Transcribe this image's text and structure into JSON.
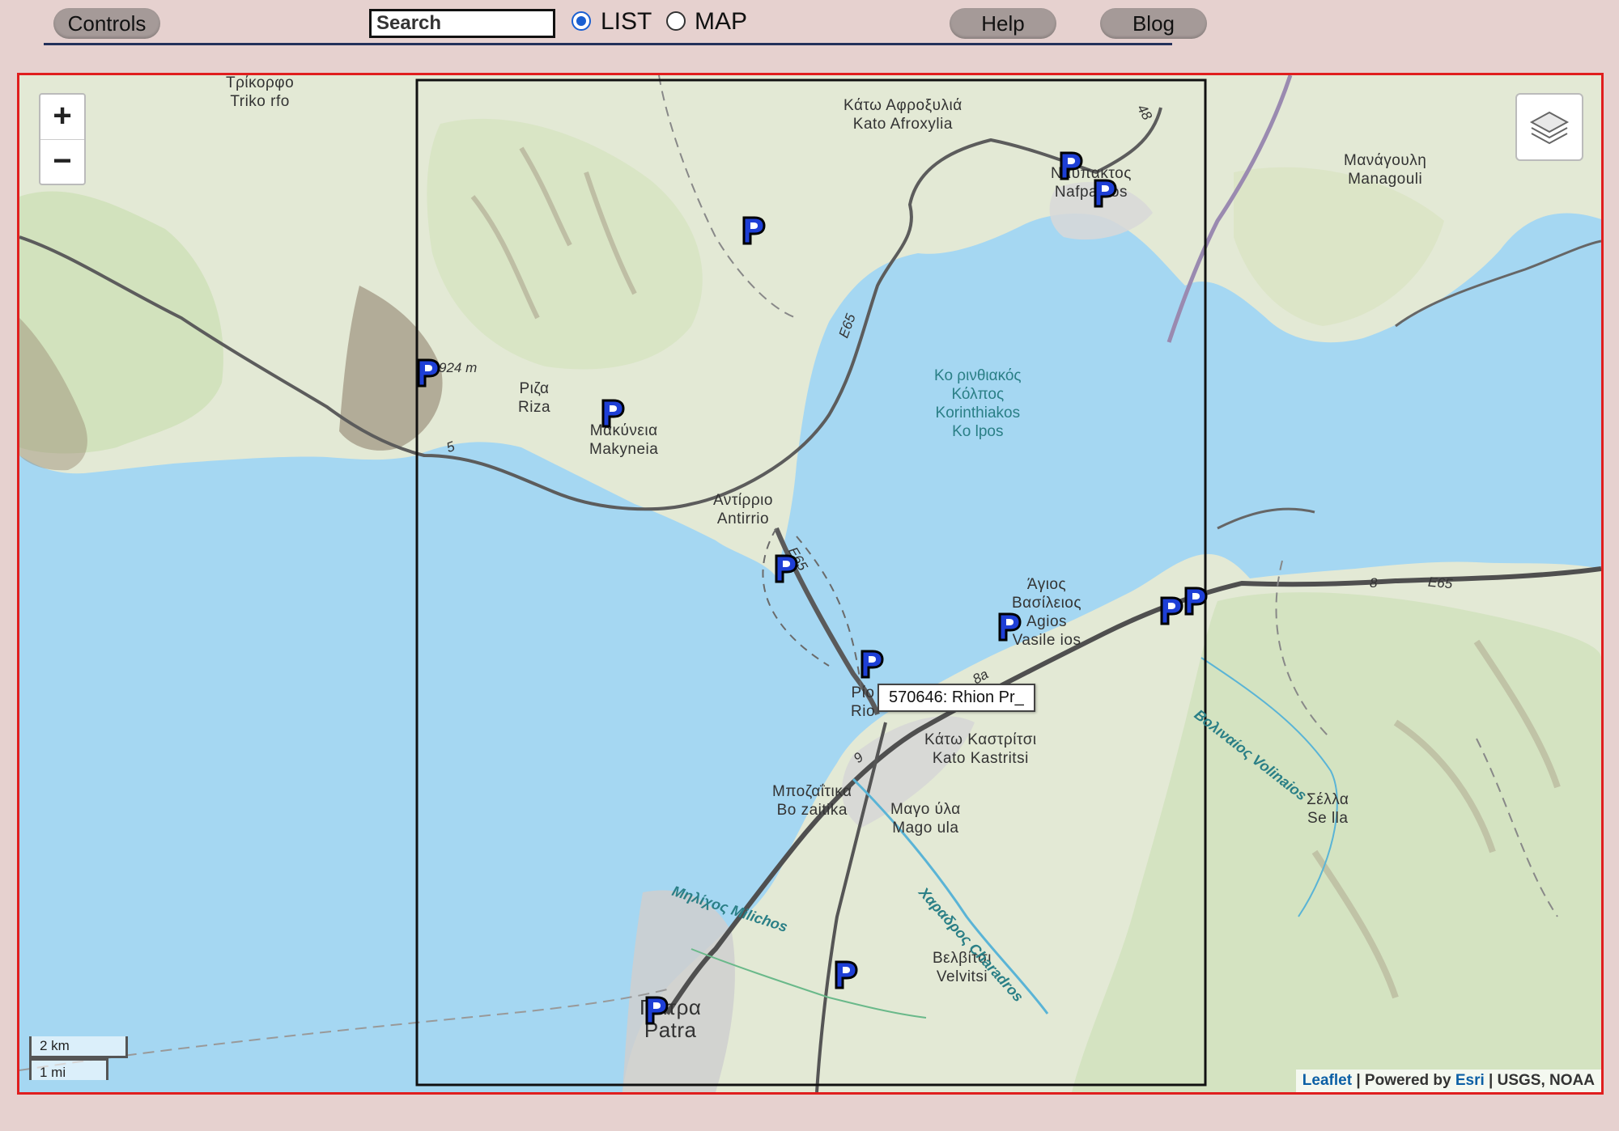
{
  "toolbar": {
    "controls_label": "Controls",
    "search_placeholder": "Search",
    "list_label": "LIST",
    "map_label": "MAP",
    "help_label": "Help",
    "blog_label": "Blog",
    "view_selected": "LIST"
  },
  "map": {
    "zoom_in": "+",
    "zoom_out": "−",
    "layers_icon": "layers-icon",
    "tooltip": "570646: Rhion Pr_",
    "scale_km": "2 km",
    "scale_mi": "1 mi",
    "attribution": {
      "leaflet": "Leaflet",
      "sep1": " | Powered by ",
      "esri": "Esri",
      "rest": " | USGS, NOAA"
    },
    "places": {
      "trikorfo_gr": "Τρίκορφο",
      "trikorfo_en": "Triko rfo",
      "afroxylia_gr": "Κάτω Αφροξυλιά",
      "afroxylia_en": "Kato Afroxylia",
      "nafpaktos_gr": "Ναυπακτος",
      "nafpaktos_en": "Nafpaktos",
      "managouli_gr": "Μανάγουλη",
      "managouli_en": "Managouli",
      "riza_gr": "Ριζα",
      "riza_en": "Riza",
      "makyneia_gr": "Μακύνεια",
      "makyneia_en": "Makyneia",
      "antirrio_gr": "Αντίρριο",
      "antirrio_en": "Antirrio",
      "gulf_gr1": "Κο ρινθιακός",
      "gulf_gr2": "Κόλπος",
      "gulf_en1": "Korinthiakos",
      "gulf_en2": "Ko lpos",
      "agios_gr1": "Άγιος",
      "agios_gr2": "Βασίλειος",
      "agios_en1": "Agios",
      "agios_en2": "Vasile ios",
      "rio_gr": "Ρίο",
      "rio_en": "Rio",
      "kastritsi_gr": "Κάτω Καστρίτσι",
      "kastritsi_en": "Kato Kastritsi",
      "bozaitika_gr": "Μποζαΐτικα",
      "bozaitika_en": "Bo zaitika",
      "magoula_gr": "Μαγο ύλα",
      "magoula_en": "Mago ula",
      "sella_gr": "Σέλλα",
      "sella_en": "Se lla",
      "velvitsi_gr": "Βελβίτσι",
      "velvitsi_en": "Velvitsi",
      "patra_gr": "Πάτρα",
      "patra_en": "Patra",
      "volinaios": "Βολιναίος Volinaios",
      "milichos": "Μηλίχος Milichos",
      "charadros": "Χαραδρος Charadros",
      "elev": "924 m",
      "road_e65_a": "E65",
      "road_e65_b": "E65",
      "road_e65_c": "E65",
      "road_48": "48",
      "road_5": "5",
      "road_8": "8",
      "road_8a": "8a",
      "road_9": "9"
    }
  }
}
